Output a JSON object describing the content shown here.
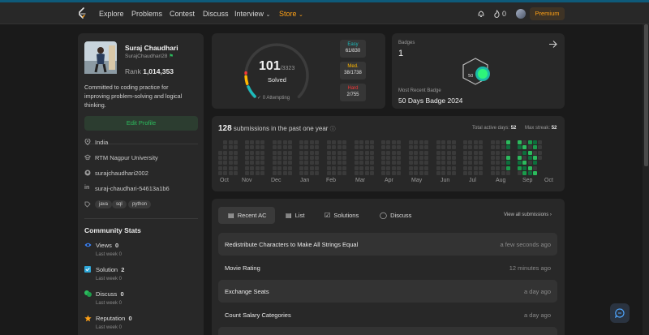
{
  "nav": {
    "items": [
      "Explore",
      "Problems",
      "Contest",
      "Discuss",
      "Interview",
      "Store"
    ],
    "notifications_count": "0",
    "premium_label": "Premium"
  },
  "profile": {
    "name": "Suraj Chaudhari",
    "username": "SurajChaudhari28",
    "rank_label": "Rank",
    "rank_value": "1,014,353",
    "bio": "Committed to coding practice for improving problem-solving and logical thinking.",
    "edit_label": "Edit Profile",
    "location": "India",
    "university": "RTM Nagpur University",
    "github": "surajchaudhari2002",
    "linkedin": "suraj-chaudhari-54613a1b6",
    "skills": [
      "java",
      "sql",
      "python"
    ]
  },
  "community": {
    "title": "Community Stats",
    "stats": [
      {
        "label": "Views",
        "value": "0",
        "sub": "Last week 0"
      },
      {
        "label": "Solution",
        "value": "2",
        "sub": "Last week 0"
      },
      {
        "label": "Discuss",
        "value": "0",
        "sub": "Last week 0"
      },
      {
        "label": "Reputation",
        "value": "0",
        "sub": "Last week 0"
      }
    ]
  },
  "solved": {
    "solved": "101",
    "total": "/3323",
    "label": "Solved",
    "attempting": "0 Attempting",
    "progress": 0.0304,
    "easy": {
      "label": "Easy",
      "value": "61/830",
      "color": "#1cbaba"
    },
    "medium": {
      "label": "Med.",
      "value": "38/1738",
      "color": "#ffb700"
    },
    "hard": {
      "label": "Hard",
      "value": "2/755",
      "color": "#f63737"
    }
  },
  "badges": {
    "title": "Badges",
    "count": "1",
    "recent_label": "Most Recent Badge",
    "recent_name": "50 Days Badge 2024",
    "badge_icon_text": "50"
  },
  "submissions": {
    "count": "128",
    "label": "submissions in the past one year",
    "active_days_label": "Total active days:",
    "active_days": "52",
    "max_streak_label": "Max streak:",
    "max_streak": "52",
    "months": [
      "Oct",
      "Nov",
      "Dec",
      "Jan",
      "Feb",
      "Mar",
      "Apr",
      "May",
      "Jun",
      "Jul",
      "Aug",
      "Sep",
      "Oct"
    ]
  },
  "recent": {
    "tabs": [
      "Recent AC",
      "List",
      "Solutions",
      "Discuss"
    ],
    "view_all": "View all submissions",
    "items": [
      {
        "title": "Redistribute Characters to Make All Strings Equal",
        "time": "a few seconds ago"
      },
      {
        "title": "Movie Rating",
        "time": "12 minutes ago"
      },
      {
        "title": "Exchange Seats",
        "time": "a day ago"
      },
      {
        "title": "Count Salary Categories",
        "time": "a day ago"
      }
    ]
  },
  "colors": {
    "accent": "#ffa116",
    "green": "#2cbb5d",
    "views": "#3b82f6",
    "solution": "#2ea7d8",
    "discuss": "#2cbb5d",
    "reputation": "#ffa116"
  }
}
